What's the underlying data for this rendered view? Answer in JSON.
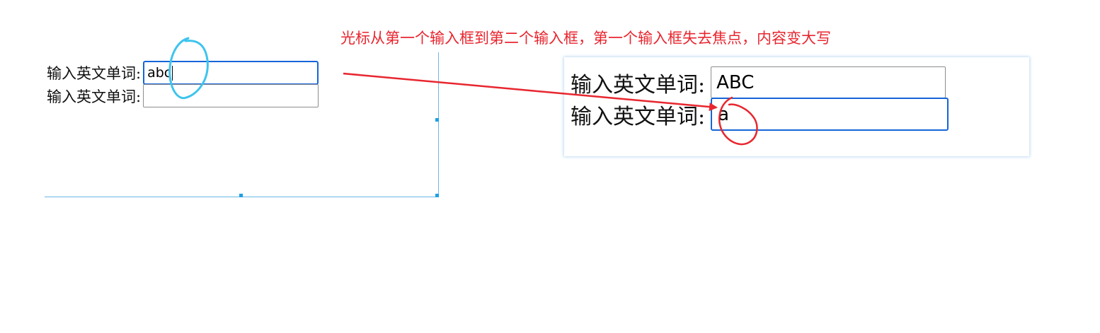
{
  "annotation": {
    "title": "光标从第一个输入框到第二个输入框，第一个输入框失去焦点，内容变大写",
    "color": "#e8262f",
    "circle_before_color": "#3ec4ee",
    "circle_after_color": "#e8262f"
  },
  "before_panel": {
    "rows": [
      {
        "label": "输入英文单词:",
        "value": "abc",
        "focused": true
      },
      {
        "label": "输入英文单词:",
        "value": "",
        "focused": false
      }
    ]
  },
  "after_panel": {
    "rows": [
      {
        "label": "输入英文单词:",
        "value": "ABC",
        "focused": false
      },
      {
        "label": "输入英文单词:",
        "value": "a",
        "focused": true
      }
    ]
  },
  "colors": {
    "focus_border": "#1565d8",
    "field_border": "#8d8d8d",
    "selection_handle": "#1ea0e6"
  }
}
